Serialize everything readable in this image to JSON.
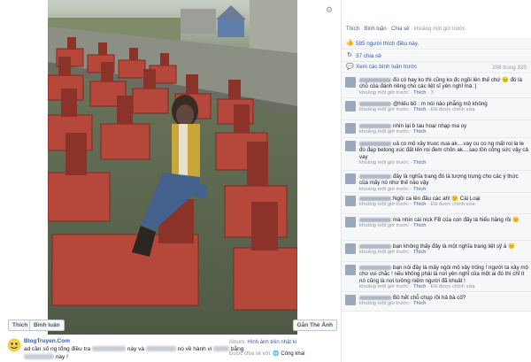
{
  "photo": {
    "like_label": "Thích",
    "comment_label": "Bình luận",
    "tag_label": "Gắn Thẻ Ảnh"
  },
  "caption": {
    "logo_text": "BlogTruyen.Com",
    "line1_a": "ad cần số ng tổng điều tra",
    "line1_b": "này và",
    "line1_c": "nó về hành vi",
    "line1_d": "bằng",
    "line2": "này !",
    "album_label": "Album:",
    "album_link": "Hình ảnh trên nhật kí",
    "share_label": "Được chia sẻ với:",
    "share_value": "Công khai"
  },
  "panel": {
    "actions": [
      "Thích",
      "Bình luận",
      "Chia sẻ"
    ],
    "action_time": "khoảng một giờ trước",
    "likes": "585 người thích điều này.",
    "shares": "37 chia sẻ",
    "prev_comments": "Xem các bình luận trước",
    "prev_count": "206 trong 320"
  },
  "comments": [
    {
      "text": "đù có hay ko thì cũng ko đc ngồi lên thế chứ 😐 đó là chỗ của đánh riêng cho các liệt sĩ yên nghỉ mà :|",
      "time": "khoảng một giờ trước",
      "likes": "Thích",
      "likes_n": "3"
    },
    {
      "text": "@hiếu bồ : m nói nào phẫng mồ không",
      "time": "khoảng một giờ trước",
      "likes": "Thích",
      "likes_n": "Đã được chỉnh sửa"
    },
    {
      "text": "nhìn lại b tau hoạ/ nhạp ma oy",
      "time": "khoảng một giờ trước",
      "likes": "Thích",
      "likes_n": ""
    },
    {
      "text": "uả co mộ xây truoc nua ak....vay cu co ng mất roi la le đo đạp betong xúc đất lên roi đem chôn ak....sao tồn công sức vậy cả vay",
      "time": "khoảng một giờ trước",
      "likes": "Thích",
      "likes_n": ""
    },
    {
      "text": "đây là nghĩa trang đó là tượng trưng cho các ý thức của mấy nó như thế nào vậy",
      "time": "khoảng một giờ trước",
      "likes": "Thích",
      "likes_n": ""
    },
    {
      "text": "Ngồi ca lên đầu các ah! 😐 Cái Loại",
      "time": "khoảng một giờ trước",
      "likes": "Thích",
      "likes_n": "Đã được chỉnh sửa"
    },
    {
      "text": "mà nhìn cái nick FB của con đấy là hiểu hăng rồi 😐",
      "time": "khoảng một giờ trước",
      "likes": "Thích",
      "likes_n": ""
    },
    {
      "text": "bạn không thấy đây là một nghĩa trang liệt sỹ à 😐",
      "time": "khoảng một giờ trước",
      "likes": "Thích",
      "likes_n": ""
    },
    {
      "text": "bạn nói đây là mấy ngôi mộ xây trống ! người ta xây mộ cho vui chắc ! nếu không phải là nơi yên nghỉ của một ai đó thì chỉ ít nó cũng là nơi tưởng niệm người đã khuất !",
      "time": "khoảng một giờ trước",
      "likes": "Thích",
      "likes_n": "Đã được chỉnh sửa"
    },
    {
      "text": "Bỏ hết chỗ chụp rồi hả bà cố?",
      "time": "khoảng một giờ trước",
      "likes": "Thích",
      "likes_n": ""
    }
  ]
}
